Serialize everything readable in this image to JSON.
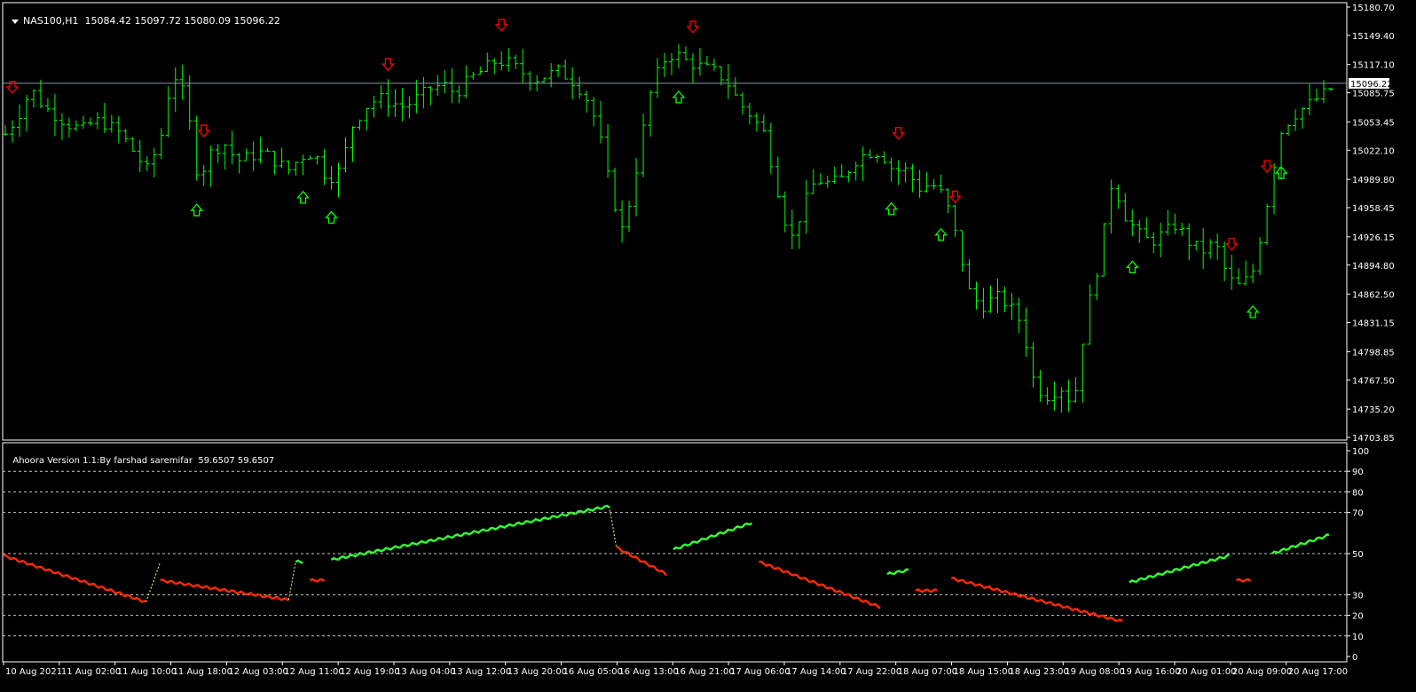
{
  "price_header": {
    "symbol": "NAS100,H1",
    "ohlc": "15084.42 15097.72 15080.09 15096.22"
  },
  "indicator_header": {
    "name": "Ahoora Version 1.1:By farshad saremifar",
    "values": "59.6507 59.6507"
  },
  "colors": {
    "background": "#000000",
    "candle": "#00ff00",
    "indicator_up": "#33ff33",
    "indicator_down": "#ff2a00",
    "indicator_transition": "#ffff66",
    "sell_arrow": "#ff0000",
    "buy_arrow": "#00ff00",
    "grid": "#c8c8c8",
    "current_price_line": "#8a99a8"
  },
  "chart_data": [
    {
      "type": "ohlc",
      "series_label": "NAS100,H1",
      "y_range": [
        14703.85,
        15180.7
      ],
      "y_ticks": [
        "15180.70",
        "15149.40",
        "15117.10",
        "15085.75",
        "15053.45",
        "15022.10",
        "14989.80",
        "14958.45",
        "14926.15",
        "14894.80",
        "14862.50",
        "14831.15",
        "14798.85",
        "14767.50",
        "14735.20",
        "14703.85"
      ],
      "current_price": 15096.22,
      "current_price_label": "15096.22",
      "close_path": [
        15040,
        15060,
        15090,
        15070,
        15060,
        15050,
        15045,
        15055,
        15050,
        15040,
        15020,
        15000,
        15030,
        15110,
        15080,
        14990,
        15020,
        15030,
        15010,
        15015,
        15020,
        15010,
        15000,
        15015,
        15020,
        14990,
        15000,
        15050,
        15070,
        15080,
        15075,
        15070,
        15080,
        15090,
        15095,
        15085,
        15100,
        15110,
        15120,
        15120,
        15110,
        15100,
        15105,
        15110,
        15100,
        15085,
        15050,
        14980,
        14930,
        15000,
        15080,
        15120,
        15130,
        15120,
        15115,
        15110,
        15100,
        15075,
        15060,
        15040,
        14980,
        14920,
        14960,
        14990,
        14985,
        14990,
        15010,
        15020,
        15020,
        15000,
        15000,
        14980,
        14985,
        14970,
        14920,
        14860,
        14850,
        14860,
        14850,
        14830,
        14760,
        14750,
        14760,
        14740,
        14840,
        14900,
        14990,
        14950,
        14930,
        14920,
        14930,
        14940,
        14920,
        14910,
        14920,
        14880,
        14870,
        14890,
        14960,
        15040,
        15060,
        15070,
        15080,
        15090
      ],
      "sell_arrows_at": [
        1,
        28,
        54,
        70,
        97,
        126,
        134,
        173,
        178
      ],
      "buy_arrows_at": [
        27,
        42,
        46,
        95,
        125,
        132,
        159,
        176,
        180
      ]
    },
    {
      "type": "line",
      "series_label": "Ahoora Version 1.1:By farshad saremifar",
      "y_range": [
        0,
        100
      ],
      "y_ticks": [
        "100",
        "90",
        "80",
        "70",
        "50",
        "30",
        "20",
        "10",
        "0"
      ],
      "dashed_levels": [
        90,
        80,
        70,
        50,
        30,
        20,
        10
      ],
      "segments": [
        {
          "color": "down",
          "from": 0,
          "to": 20,
          "start": 49,
          "end": 26.5
        },
        {
          "color": "transition",
          "from": 20,
          "to": 22,
          "start": 26.5,
          "end": 46
        },
        {
          "color": "down",
          "from": 22,
          "to": 40,
          "start": 37,
          "end": 27.5
        },
        {
          "color": "transition",
          "from": 40,
          "to": 41,
          "start": 27.5,
          "end": 46
        },
        {
          "color": "up",
          "from": 41,
          "to": 42,
          "start": 46,
          "end": 46
        },
        {
          "color": "down",
          "from": 43,
          "to": 45,
          "start": 37,
          "end": 37
        },
        {
          "color": "up",
          "from": 46,
          "to": 85,
          "start": 47,
          "end": 73
        },
        {
          "color": "transition",
          "from": 85,
          "to": 86,
          "start": 73,
          "end": 53
        },
        {
          "color": "down",
          "from": 86,
          "to": 93,
          "start": 53,
          "end": 40
        },
        {
          "color": "up",
          "from": 94,
          "to": 105,
          "start": 52,
          "end": 65
        },
        {
          "color": "down",
          "from": 106,
          "to": 123,
          "start": 46,
          "end": 24
        },
        {
          "color": "up",
          "from": 124,
          "to": 127,
          "start": 40,
          "end": 42
        },
        {
          "color": "down",
          "from": 128,
          "to": 131,
          "start": 32,
          "end": 32
        },
        {
          "color": "down",
          "from": 133,
          "to": 157,
          "start": 38,
          "end": 17
        },
        {
          "color": "up",
          "from": 158,
          "to": 172,
          "start": 36,
          "end": 49
        },
        {
          "color": "down",
          "from": 173,
          "to": 175,
          "start": 37,
          "end": 37
        },
        {
          "color": "up",
          "from": 178,
          "to": 186,
          "start": 50,
          "end": 59
        }
      ]
    }
  ],
  "time_axis": {
    "labels": [
      "10 Aug 2021",
      "11 Aug 02:00",
      "11 Aug 10:00",
      "11 Aug 18:00",
      "12 Aug 03:00",
      "12 Aug 11:00",
      "12 Aug 19:00",
      "13 Aug 04:00",
      "13 Aug 12:00",
      "13 Aug 20:00",
      "16 Aug 05:00",
      "16 Aug 13:00",
      "16 Aug 21:00",
      "17 Aug 06:00",
      "17 Aug 14:00",
      "17 Aug 22:00",
      "18 Aug 07:00",
      "18 Aug 15:00",
      "18 Aug 23:00",
      "19 Aug 08:00",
      "19 Aug 16:00",
      "20 Aug 01:00",
      "20 Aug 09:00",
      "20 Aug 17:00"
    ]
  }
}
